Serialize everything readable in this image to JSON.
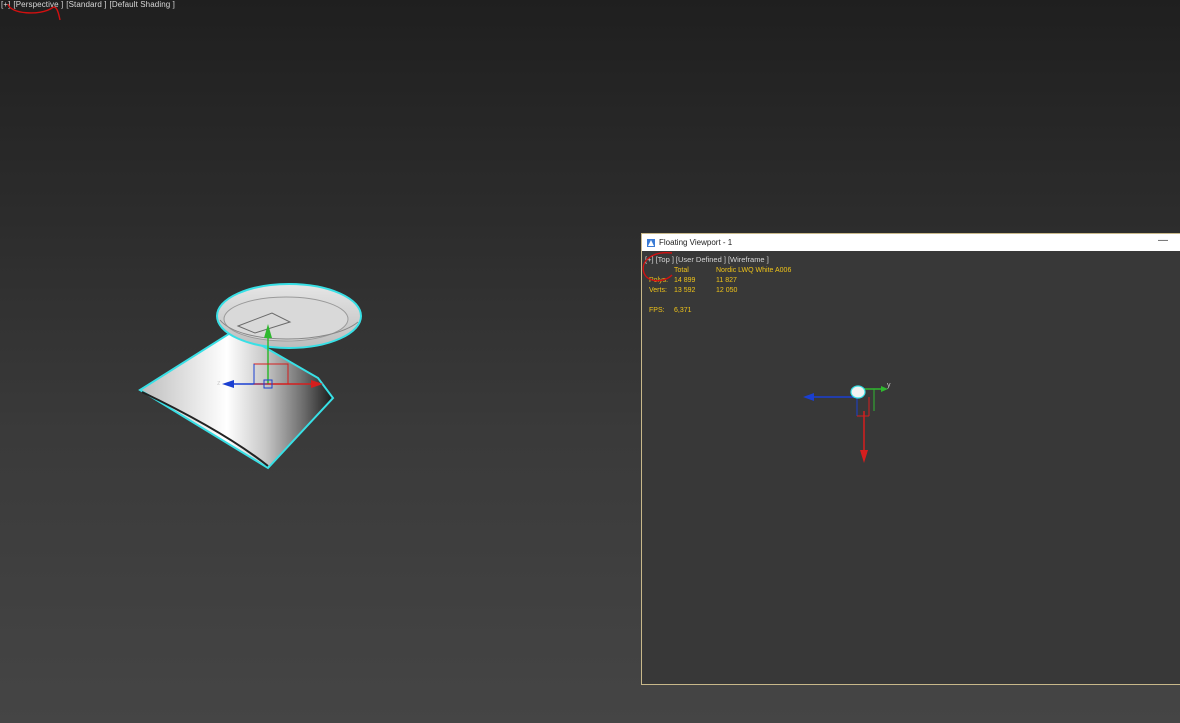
{
  "main_viewport": {
    "labels": [
      "[+]",
      "[Perspective ]",
      "[Standard ]",
      "[Default Shading ]"
    ]
  },
  "floating_window": {
    "title": "Floating Viewport - 1",
    "minimize_glyph": "—",
    "viewport_labels": [
      "[+]",
      "[Top ]",
      "[User Defined ]",
      "[Wireframe ]"
    ],
    "stats": {
      "header": [
        "",
        "Total",
        "Nordic LWQ White A006"
      ],
      "rows": [
        [
          "Polys:",
          "14 899",
          "11 827"
        ],
        [
          "Verts:",
          "13 592",
          "12 050"
        ]
      ],
      "fps_label": "FPS:",
      "fps_value": "6,371"
    }
  },
  "gizmo_axes": {
    "main": {
      "x": "",
      "y": "",
      "z": "z"
    },
    "floating": {
      "y": "y"
    }
  },
  "colors": {
    "selection": "#38e0e6",
    "annotation": "#d21010",
    "axis_x": "#d61e1e",
    "axis_y": "#2fb82f",
    "axis_z": "#1a3fd1",
    "stats_text": "#f0c419"
  },
  "icons": [
    "app-icon",
    "minimize-icon"
  ]
}
